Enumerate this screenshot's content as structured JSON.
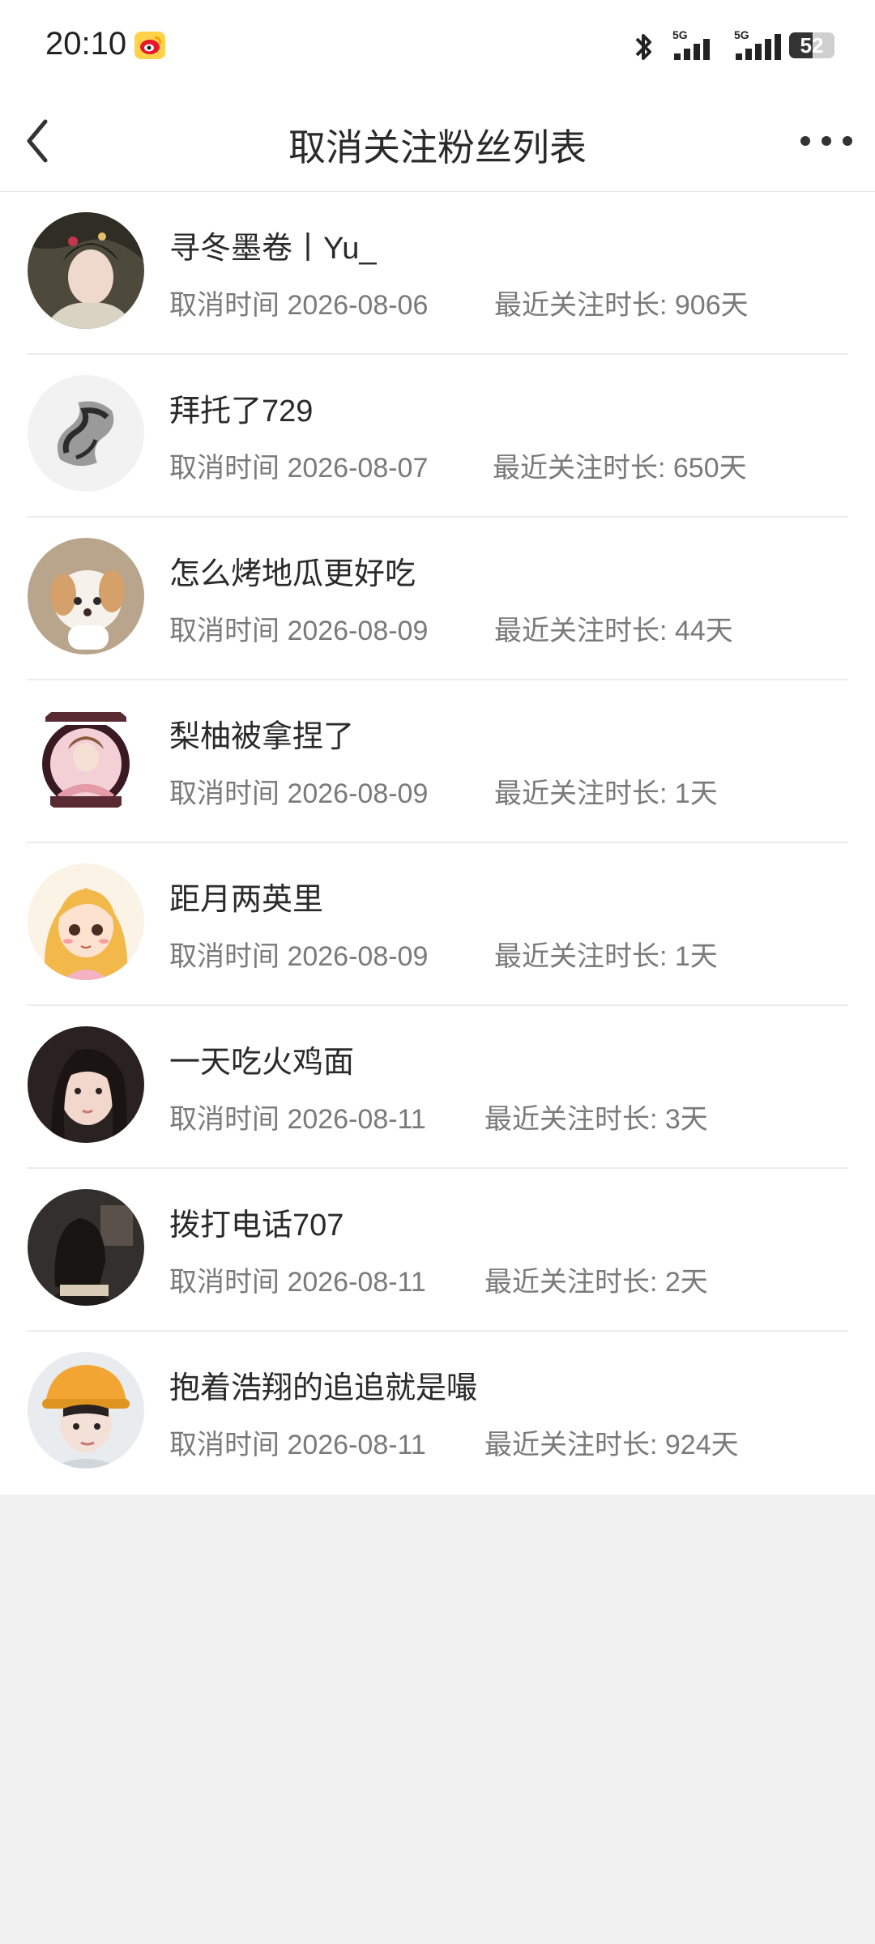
{
  "status_bar": {
    "time": "20:10",
    "battery_level": "52",
    "battery_fraction": 0.52,
    "network_1": "5G",
    "network_2": "5G",
    "app_icon": "weibo-icon"
  },
  "header": {
    "title": "取消关注粉丝列表",
    "back_icon": "chevron-left-icon",
    "more_icon": "more-dots-icon"
  },
  "colors": {
    "background": "#f1f1f1",
    "text_primary": "#2a2a2a",
    "text_secondary": "#7a7a7a"
  },
  "list": [
    {
      "name": "寻冬墨卷丨Yu_",
      "unfollow": "取消时间 2026-08-06",
      "duration": "最近关注时长: 906天"
    },
    {
      "name": "拜托了729",
      "unfollow": "取消时间 2026-08-07",
      "duration": "最近关注时长: 650天"
    },
    {
      "name": "怎么烤地瓜更好吃",
      "unfollow": "取消时间 2026-08-09",
      "duration": "最近关注时长: 44天"
    },
    {
      "name": "梨柚被拿捏了",
      "unfollow": "取消时间 2026-08-09",
      "duration": "最近关注时长: 1天"
    },
    {
      "name": "距月两英里",
      "unfollow": "取消时间 2026-08-09",
      "duration": "最近关注时长: 1天"
    },
    {
      "name": "一天吃火鸡面",
      "unfollow": "取消时间 2026-08-11",
      "duration": "最近关注时长: 3天"
    },
    {
      "name": "拨打电话707",
      "unfollow": "取消时间 2026-08-11",
      "duration": "最近关注时长: 2天"
    },
    {
      "name": "抱着浩翔的追追就是嘬",
      "unfollow": "取消时间 2026-08-11",
      "duration": "最近关注时长: 924天"
    }
  ]
}
